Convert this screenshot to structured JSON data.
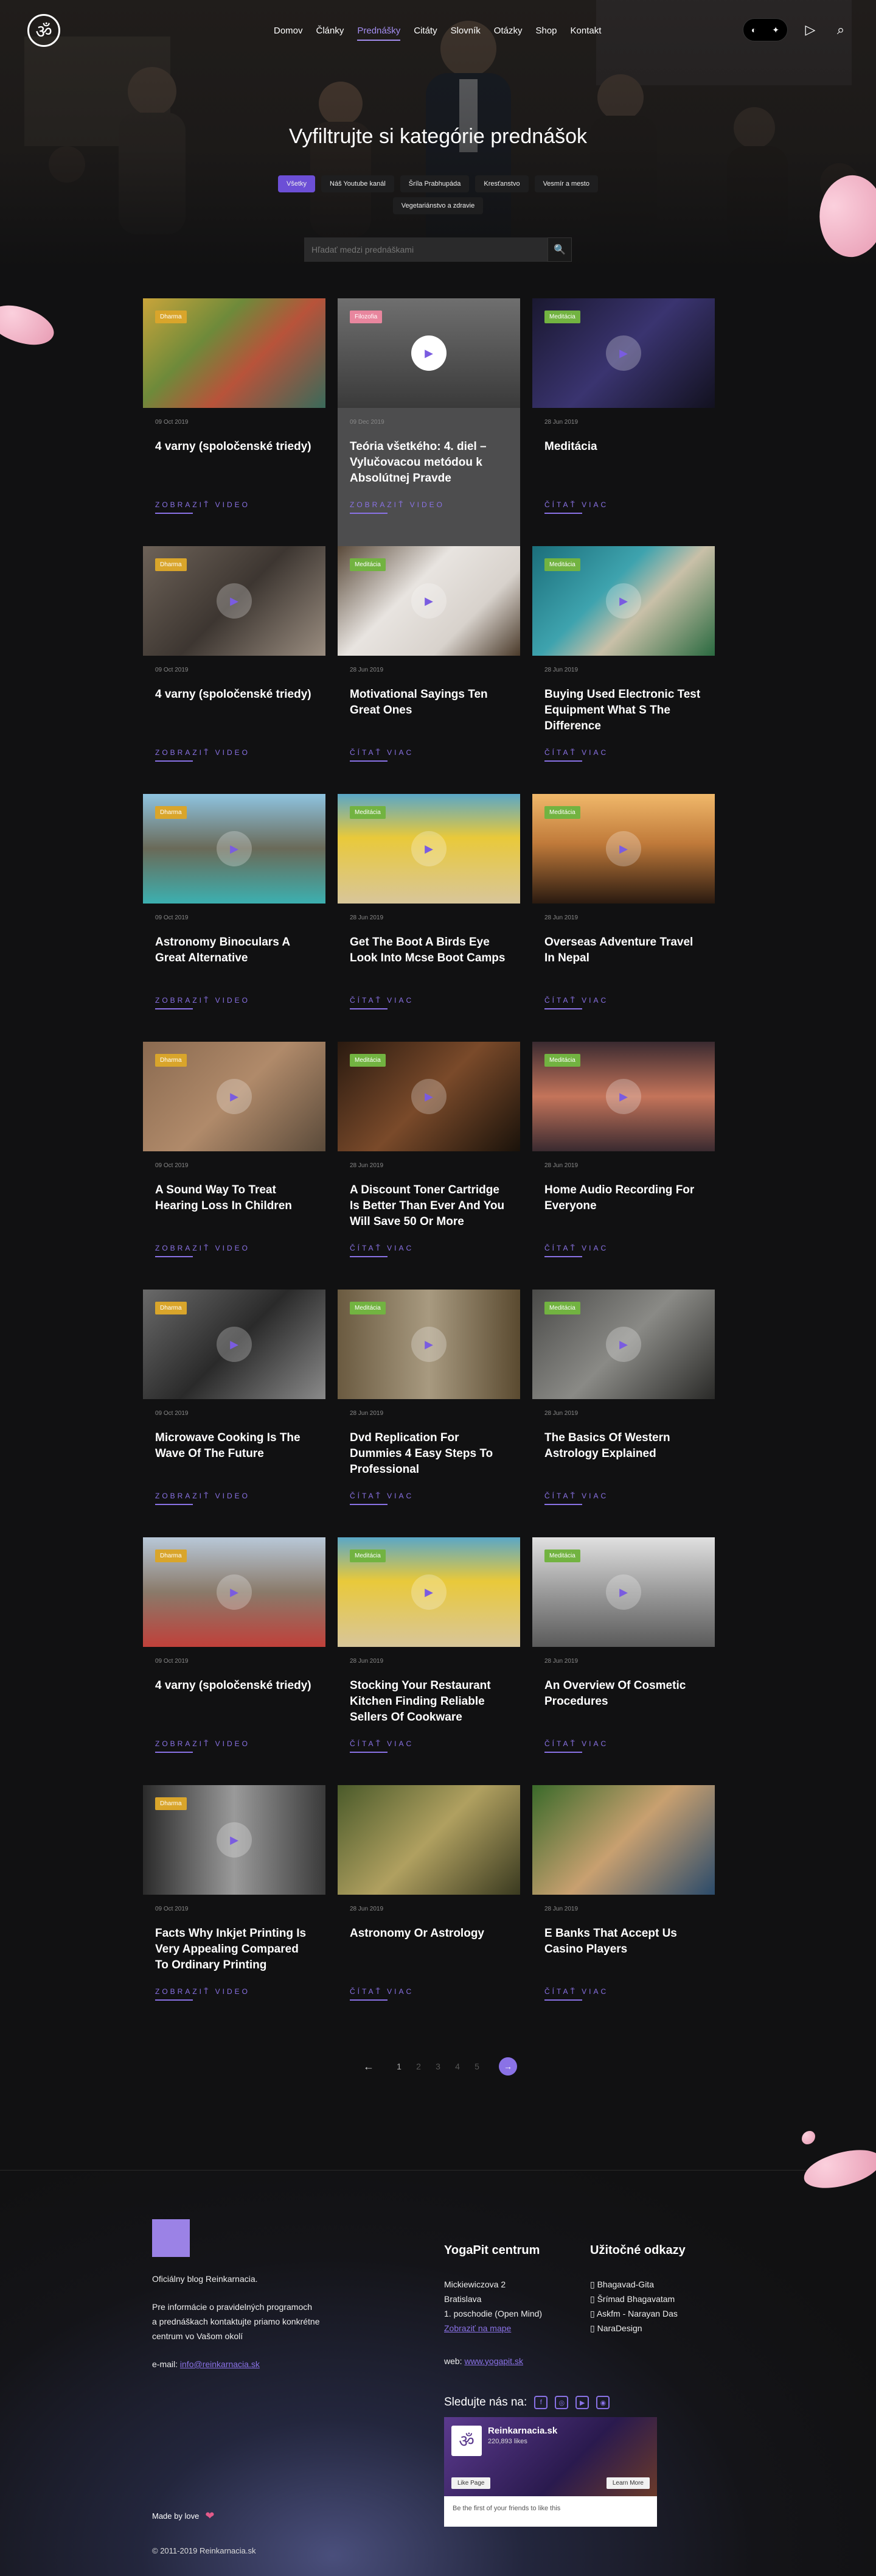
{
  "nav": {
    "logo_glyph": "ॐ",
    "items": [
      "Domov",
      "Články",
      "Prednášky",
      "Citáty",
      "Slovník",
      "Otázky",
      "Shop",
      "Kontakt"
    ],
    "active_index": 2,
    "toggle_moon": "◐",
    "toggle_sun": "✦",
    "play_icon": "▷",
    "search_icon": "⌕"
  },
  "hero": {
    "title": "Vyfiltrujte si kategórie prednášok",
    "filters": [
      "Všetky",
      "Náš Youtube kanál",
      "Šríla Prabhupáda",
      "Kresťanstvo",
      "Vesmír a mesto",
      "Vegetariánstvo a zdravie"
    ],
    "active_filter": 0,
    "search_placeholder": "Hľadať medzi prednáškami",
    "search_button": "🔍"
  },
  "cards": [
    {
      "category": "Dharma",
      "type": "dharma",
      "date": "09 Oct 2019",
      "title": "4 varny (spoločenské triedy)",
      "more": "ZOBRAZIŤ VIDEO",
      "play": false,
      "featured": false,
      "bg": "linear-gradient(135deg,#c9a43a,#6e8a3a 35%,#b8533a 60%,#3a6a5a)"
    },
    {
      "category": "Filozofia",
      "type": "filozofia",
      "date": "09 Dec 2019",
      "title": "Teória všetkého: 4. diel – Vylučovacou metódou k Absolútnej Pravde",
      "more": "ZOBRAZIŤ VIDEO",
      "play": true,
      "featured": true,
      "bg": "linear-gradient(180deg,#6f6f6f,#3a3a3a)"
    },
    {
      "category": "Meditácia",
      "type": "meditacia",
      "date": "28 Jun 2019",
      "title": "Meditácia",
      "more": "ČÍTAŤ VIAC",
      "play": true,
      "featured": false,
      "bg": "linear-gradient(135deg,#1a1830,#3a3470 50%,#12111f)"
    },
    {
      "category": "Dharma",
      "type": "dharma",
      "date": "09 Oct 2019",
      "title": "4 varny (spoločenské triedy)",
      "more": "ZOBRAZIŤ VIDEO",
      "play": true,
      "featured": false,
      "bg": "linear-gradient(135deg,#6d6258,#3d3631 50%,#9a8d80)"
    },
    {
      "category": "Meditácia",
      "type": "meditacia",
      "date": "28 Jun 2019",
      "title": "Motivational Sayings Ten Great Ones",
      "more": "ČÍTAŤ VIAC",
      "play": true,
      "featured": false,
      "bg": "linear-gradient(135deg,#5a4a3a,#e8e4e0 40%,#d8d2cc 70%,#4a3a2a)"
    },
    {
      "category": "Meditácia",
      "type": "meditacia",
      "date": "28 Jun 2019",
      "title": "Buying Used Electronic Test Equipment What S The Difference",
      "more": "ČÍTAŤ VIAC",
      "play": true,
      "featured": false,
      "bg": "linear-gradient(135deg,#1b6e7a,#3ea3ae 40%,#c9c0a8 60%,#2a6a40)"
    },
    {
      "category": "Dharma",
      "type": "dharma",
      "date": "09 Oct 2019",
      "title": "Astronomy Binoculars A Great Alternative",
      "more": "ZOBRAZIŤ VIDEO",
      "play": true,
      "featured": false,
      "bg": "linear-gradient(180deg,#8ec4e0,#6a6a58 50%,#3cb0b0)"
    },
    {
      "category": "Meditácia",
      "type": "meditacia",
      "date": "28 Jun 2019",
      "title": "Get The Boot A Birds Eye Look Into Mcse Boot Camps",
      "more": "ČÍTAŤ VIAC",
      "play": true,
      "featured": false,
      "bg": "linear-gradient(180deg,#5aa7c7,#e9c93a 40%,#d8c69a)"
    },
    {
      "category": "Meditácia",
      "type": "meditacia",
      "date": "28 Jun 2019",
      "title": "Overseas Adventure Travel In Nepal",
      "more": "ČÍTAŤ VIAC",
      "play": true,
      "featured": false,
      "bg": "linear-gradient(180deg,#f0b86a,#c07a3a 45%,#2a1a10)"
    },
    {
      "category": "Dharma",
      "type": "dharma",
      "date": "09 Oct 2019",
      "title": "A Sound Way To Treat Hearing Loss In Children",
      "more": "ZOBRAZIŤ VIDEO",
      "play": true,
      "featured": false,
      "bg": "linear-gradient(135deg,#8a6a50,#b08a6a 50%,#5a4a3a)"
    },
    {
      "category": "Meditácia",
      "type": "meditacia",
      "date": "28 Jun 2019",
      "title": "A Discount Toner Cartridge Is Better Than Ever And You Will Save 50 Or More",
      "more": "ČÍTAŤ VIAC",
      "play": true,
      "featured": false,
      "bg": "linear-gradient(135deg,#2a1a10,#7a4a2a 50%,#1a120a)"
    },
    {
      "category": "Meditácia",
      "type": "meditacia",
      "date": "28 Jun 2019",
      "title": "Home Audio Recording For Everyone",
      "more": "ČÍTAŤ VIAC",
      "play": true,
      "featured": false,
      "bg": "linear-gradient(180deg,#3a2a30,#c4745a 50%,#3a2a30)"
    },
    {
      "category": "Dharma",
      "type": "dharma",
      "date": "09 Oct 2019",
      "title": "Microwave Cooking Is The Wave Of The Future",
      "more": "ZOBRAZIŤ VIDEO",
      "play": true,
      "featured": false,
      "bg": "linear-gradient(135deg,#6a6a6a,#2a2a2a 50%,#8a8a8a)"
    },
    {
      "category": "Meditácia",
      "type": "meditacia",
      "date": "28 Jun 2019",
      "title": "Dvd Replication For Dummies 4 Easy Steps To Professional",
      "more": "ČÍTAŤ VIAC",
      "play": true,
      "featured": false,
      "bg": "linear-gradient(90deg,#6a5a40,#a89a80 50%,#5a4a30)"
    },
    {
      "category": "Meditácia",
      "type": "meditacia",
      "date": "28 Jun 2019",
      "title": "The Basics Of Western Astrology Explained",
      "more": "ČÍTAŤ VIAC",
      "play": true,
      "featured": false,
      "bg": "linear-gradient(135deg,#4a4a48,#8a8a86 50%,#2a2a28)"
    },
    {
      "category": "Dharma",
      "type": "dharma",
      "date": "09 Oct 2019",
      "title": "4 varny (spoločenské triedy)",
      "more": "ZOBRAZIŤ VIDEO",
      "play": true,
      "featured": false,
      "bg": "linear-gradient(180deg,#b8c8d8,#8a7a6a 50%,#c0403a)"
    },
    {
      "category": "Meditácia",
      "type": "meditacia",
      "date": "28 Jun 2019",
      "title": "Stocking Your Restaurant Kitchen Finding Reliable Sellers Of Cookware",
      "more": "ČÍTAŤ VIAC",
      "play": true,
      "featured": false,
      "bg": "linear-gradient(180deg,#5aa7c7,#e9c93a 40%,#d8c69a)"
    },
    {
      "category": "Meditácia",
      "type": "meditacia",
      "date": "28 Jun 2019",
      "title": "An Overview Of Cosmetic Procedures",
      "more": "ČÍTAŤ VIAC",
      "play": true,
      "featured": false,
      "bg": "linear-gradient(180deg,#e0e0e0,#9a9a9a 50%,#5a5a5a)"
    },
    {
      "category": "Dharma",
      "type": "dharma",
      "date": "09 Oct 2019",
      "title": "Facts Why Inkjet Printing Is Very Appealing Compared To Ordinary Printing",
      "more": "ZOBRAZIŤ VIDEO",
      "play": true,
      "featured": false,
      "bg": "linear-gradient(90deg,#2a2a2a,#9a9a9a 50%,#3a3a3a)"
    },
    {
      "category": "",
      "type": "",
      "date": "28 Jun 2019",
      "title": "Astronomy Or Astrology",
      "more": "ČÍTAŤ VIAC",
      "play": false,
      "featured": false,
      "bg": "linear-gradient(135deg,#4a5a2a,#b0a060 50%,#3a3a20)"
    },
    {
      "category": "",
      "type": "",
      "date": "28 Jun 2019",
      "title": "E Banks That Accept Us Casino Players",
      "more": "ČÍTAŤ VIAC",
      "play": false,
      "featured": false,
      "bg": "linear-gradient(135deg,#3a6a2a,#c8a070 50%,#2a4a6a)"
    }
  ],
  "pagination": {
    "prev": "←",
    "pages": [
      "1",
      "2",
      "3",
      "4",
      "5"
    ],
    "current": "1",
    "next": "→"
  },
  "footer": {
    "about_lines": [
      "Oficiálny blog Reinkarnacia.",
      "Pre informácie o pravidelných programoch",
      "a prednáškach kontaktujte priamo konkrétne",
      "centrum vo Vašom okolí"
    ],
    "email_label": "e-mail: ",
    "email": "info@reinkarnacia.sk",
    "center_title": "YogaPit centrum",
    "address": [
      "Mickiewiczova 2",
      "Bratislava",
      "1. poschodie (Open Mind)"
    ],
    "map_link": "Zobraziť na mape",
    "web_label": "web: ",
    "web_link": "www.yogapit.sk",
    "links_title": "Užitočné odkazy",
    "links": [
      "Bhagavad-Gita",
      "Šrímad Bhagavatam",
      "Askfm - Narayan Das",
      "NaraDesign"
    ],
    "follow_label": "Sledujte nás na:",
    "social": [
      "f",
      "◎",
      "▶",
      "◉"
    ],
    "fb_name": "Reinkarnacia.sk",
    "fb_likes": "220,893 likes",
    "fb_like_btn": "Like Page",
    "fb_learn_btn": "Learn More",
    "fb_first": "Be the first of your friends to like this",
    "made_by": "Made by love",
    "copyright": "© 2011-2019 Reinkarnacia.sk"
  }
}
